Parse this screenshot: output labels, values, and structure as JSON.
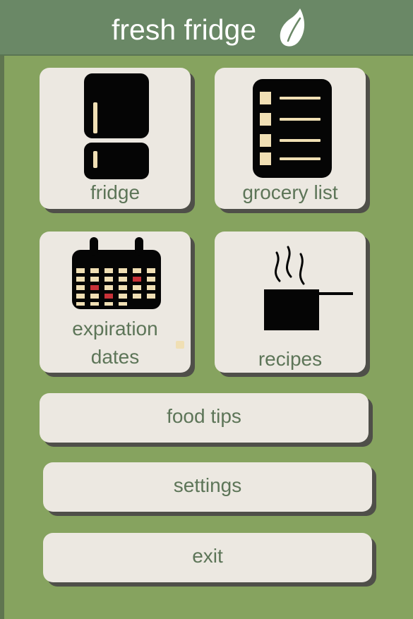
{
  "app": {
    "title": "fresh fridge",
    "logo_icon": "leaf-icon",
    "colors": {
      "background": "#86a35f",
      "header": "#6a8866",
      "tile": "#ece8e1",
      "label": "#5d7558",
      "shadow": "#4f4f49",
      "accent": "#c83238"
    }
  },
  "tiles": [
    {
      "label": "fridge",
      "icon": "fridge-icon"
    },
    {
      "label": "grocery list",
      "icon": "grocery-list-icon"
    },
    {
      "label": "expiration\ndates",
      "icon": "calendar-icon"
    },
    {
      "label": "recipes",
      "icon": "cooking-pot-icon"
    }
  ],
  "buttons": {
    "food_tips": "food tips",
    "settings": "settings",
    "exit": "exit"
  }
}
